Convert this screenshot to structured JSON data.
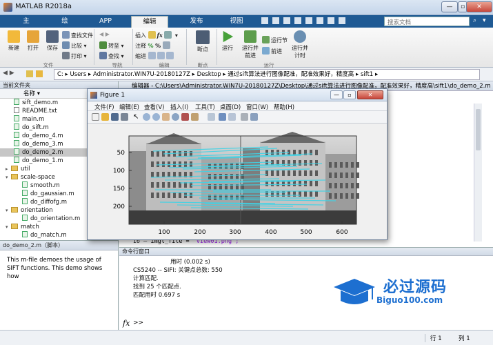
{
  "window": {
    "title": "MATLAB R2018a"
  },
  "ribbon_tabs": [
    {
      "label": "主页",
      "active": false
    },
    {
      "label": "绘图",
      "active": false
    },
    {
      "label": "APP",
      "active": false
    },
    {
      "label": "编辑器",
      "active": true
    },
    {
      "label": "发布",
      "active": false
    },
    {
      "label": "视图",
      "active": false
    }
  ],
  "search": {
    "placeholder": "搜索文档"
  },
  "ribbon": {
    "file": {
      "new": "新建",
      "open": "打开",
      "save": "保存",
      "find_files": "查找文件",
      "compare": "比较",
      "print": "打印",
      "section": "文件"
    },
    "nav": {
      "goto": "转至",
      "find": "查找",
      "section": "导航"
    },
    "edit": {
      "insert": "插入",
      "comment": "注释",
      "indent": "缩进",
      "section": "编辑"
    },
    "breakpoints": {
      "label": "断点",
      "section": "断点"
    },
    "run": {
      "run": "运行",
      "run_advance": "运行并\n前进",
      "run_section": "运行节",
      "advance": "前进",
      "run_time": "运行并\n计时",
      "section": "运行"
    }
  },
  "address": {
    "parts": [
      "C:",
      "Users",
      "Administrator.WIN7U-20180127Z",
      "Desktop",
      "通过sift算法进行图像配准，配准效果好，精度高",
      "sift1"
    ]
  },
  "current_folder": {
    "header": "当前文件夹",
    "column": "名称",
    "items": [
      {
        "name": "sift_demo.m",
        "type": "m",
        "indent": 1,
        "selected": false
      },
      {
        "name": "README.txt",
        "type": "txt",
        "indent": 1,
        "selected": false
      },
      {
        "name": "main.m",
        "type": "m",
        "indent": 1,
        "selected": false
      },
      {
        "name": "do_sift.m",
        "type": "m",
        "indent": 1,
        "selected": false
      },
      {
        "name": "do_demo_4.m",
        "type": "m",
        "indent": 1,
        "selected": false
      },
      {
        "name": "do_demo_3.m",
        "type": "m",
        "indent": 1,
        "selected": false
      },
      {
        "name": "do_demo_2.m",
        "type": "m",
        "indent": 1,
        "selected": true
      },
      {
        "name": "do_demo_1.m",
        "type": "m",
        "indent": 1,
        "selected": false
      },
      {
        "name": "util",
        "type": "folder",
        "indent": 0,
        "expanded": false
      },
      {
        "name": "scale-space",
        "type": "folder",
        "indent": 0,
        "expanded": true
      },
      {
        "name": "smooth.m",
        "type": "m",
        "indent": 2,
        "selected": false
      },
      {
        "name": "do_gaussian.m",
        "type": "m",
        "indent": 2,
        "selected": false
      },
      {
        "name": "do_diffofg.m",
        "type": "m",
        "indent": 2,
        "selected": false
      },
      {
        "name": "orientation",
        "type": "folder",
        "indent": 0,
        "expanded": true
      },
      {
        "name": "do_orientation.m",
        "type": "m",
        "indent": 2,
        "selected": false
      },
      {
        "name": "match",
        "type": "folder",
        "indent": 0,
        "expanded": true
      },
      {
        "name": "do_match.m",
        "type": "m",
        "indent": 2,
        "selected": false
      }
    ]
  },
  "details": {
    "header": "do_demo_2.m（脚本）",
    "text": "This m-file demoes the usage of SIFT functions. This demo shows how"
  },
  "editor": {
    "tab": "编辑器 - C:\\Users\\Administrator.WIN7U-20180127Z\\Desktop\\通过sift算法进行图像配准，配准效果好，精度高\\sift1\\do_demo_2.m",
    "visible_line": {
      "number": "16",
      "code_prefix": "imgl_file = ",
      "code_string": "'view01.png';"
    }
  },
  "command_window": {
    "header": "命令行窗口",
    "lines": [
      "                    用时 (0.002 s)",
      "CS5240 -- SIFI: 关键点总数: 550",
      "",
      "",
      "计算匹配.",
      "找到 25 个匹配点.",
      "匹配用时 0.697 s"
    ],
    "prompt": ">>"
  },
  "status": {
    "row_label": "行",
    "row": "1",
    "col_label": "列",
    "col": "1"
  },
  "figure": {
    "title": "Figure 1",
    "menu": [
      "文件(F)",
      "编辑(E)",
      "查看(V)",
      "插入(I)",
      "工具(T)",
      "桌面(D)",
      "窗口(W)",
      "帮助(H)"
    ],
    "y_ticks": [
      "50",
      "100",
      "150",
      "200"
    ],
    "x_ticks": [
      "100",
      "200",
      "300",
      "400",
      "500",
      "600"
    ],
    "colors": {
      "match_line": "#3fd3e6"
    }
  },
  "watermark": {
    "text1": "必过源码",
    "text2": "Biguo100.com",
    "color": "#1d6fd0"
  }
}
